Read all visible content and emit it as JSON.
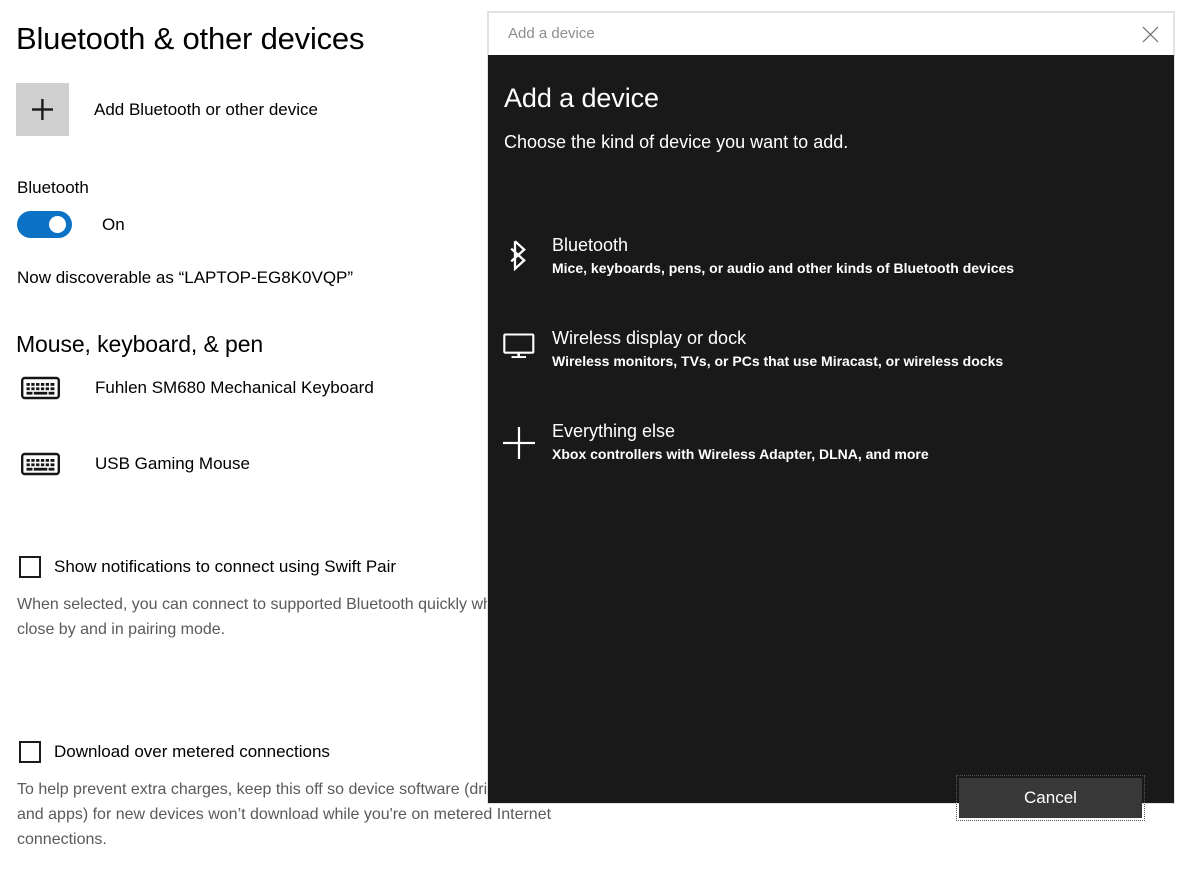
{
  "settings": {
    "page_title": "Bluetooth & other devices",
    "add_device": {
      "label": "Add Bluetooth or other device",
      "icon": "plus-icon"
    },
    "bluetooth": {
      "section_label": "Bluetooth",
      "toggle_state": "On",
      "toggle_on": true,
      "accent_color": "#0c72c6",
      "discoverable_text": "Now discoverable as “LAPTOP-EG8K0VQP”"
    },
    "devices_section": {
      "heading": "Mouse, keyboard, & pen",
      "items": [
        {
          "name": "Fuhlen SM680 Mechanical Keyboard",
          "icon": "keyboard-icon"
        },
        {
          "name": "USB Gaming Mouse",
          "icon": "keyboard-icon"
        }
      ]
    },
    "checkboxes": [
      {
        "label": "Show notifications to connect using Swift Pair",
        "checked": false,
        "help": "When selected, you can connect to supported Bluetooth quickly when they're close by and in pairing mode."
      },
      {
        "label": "Download over metered connections",
        "checked": false,
        "help": "To help prevent extra charges, keep this off so device software (drivers, info, and apps) for new devices won’t download while you're on metered Internet connections."
      }
    ]
  },
  "dialog": {
    "titlebar_text": "Add a device",
    "close_icon": "close-icon",
    "heading": "Add a device",
    "subtitle": "Choose the kind of device you want to add.",
    "background_color": "#191919",
    "options": [
      {
        "title": "Bluetooth",
        "description": "Mice, keyboards, pens, or audio and other kinds of Bluetooth devices",
        "icon": "bluetooth-icon"
      },
      {
        "title": "Wireless display or dock",
        "description": "Wireless monitors, TVs, or PCs that use Miracast, or wireless docks",
        "icon": "monitor-icon"
      },
      {
        "title": "Everything else",
        "description": "Xbox controllers with Wireless Adapter, DLNA, and more",
        "icon": "plus-icon"
      }
    ],
    "cancel_label": "Cancel"
  }
}
